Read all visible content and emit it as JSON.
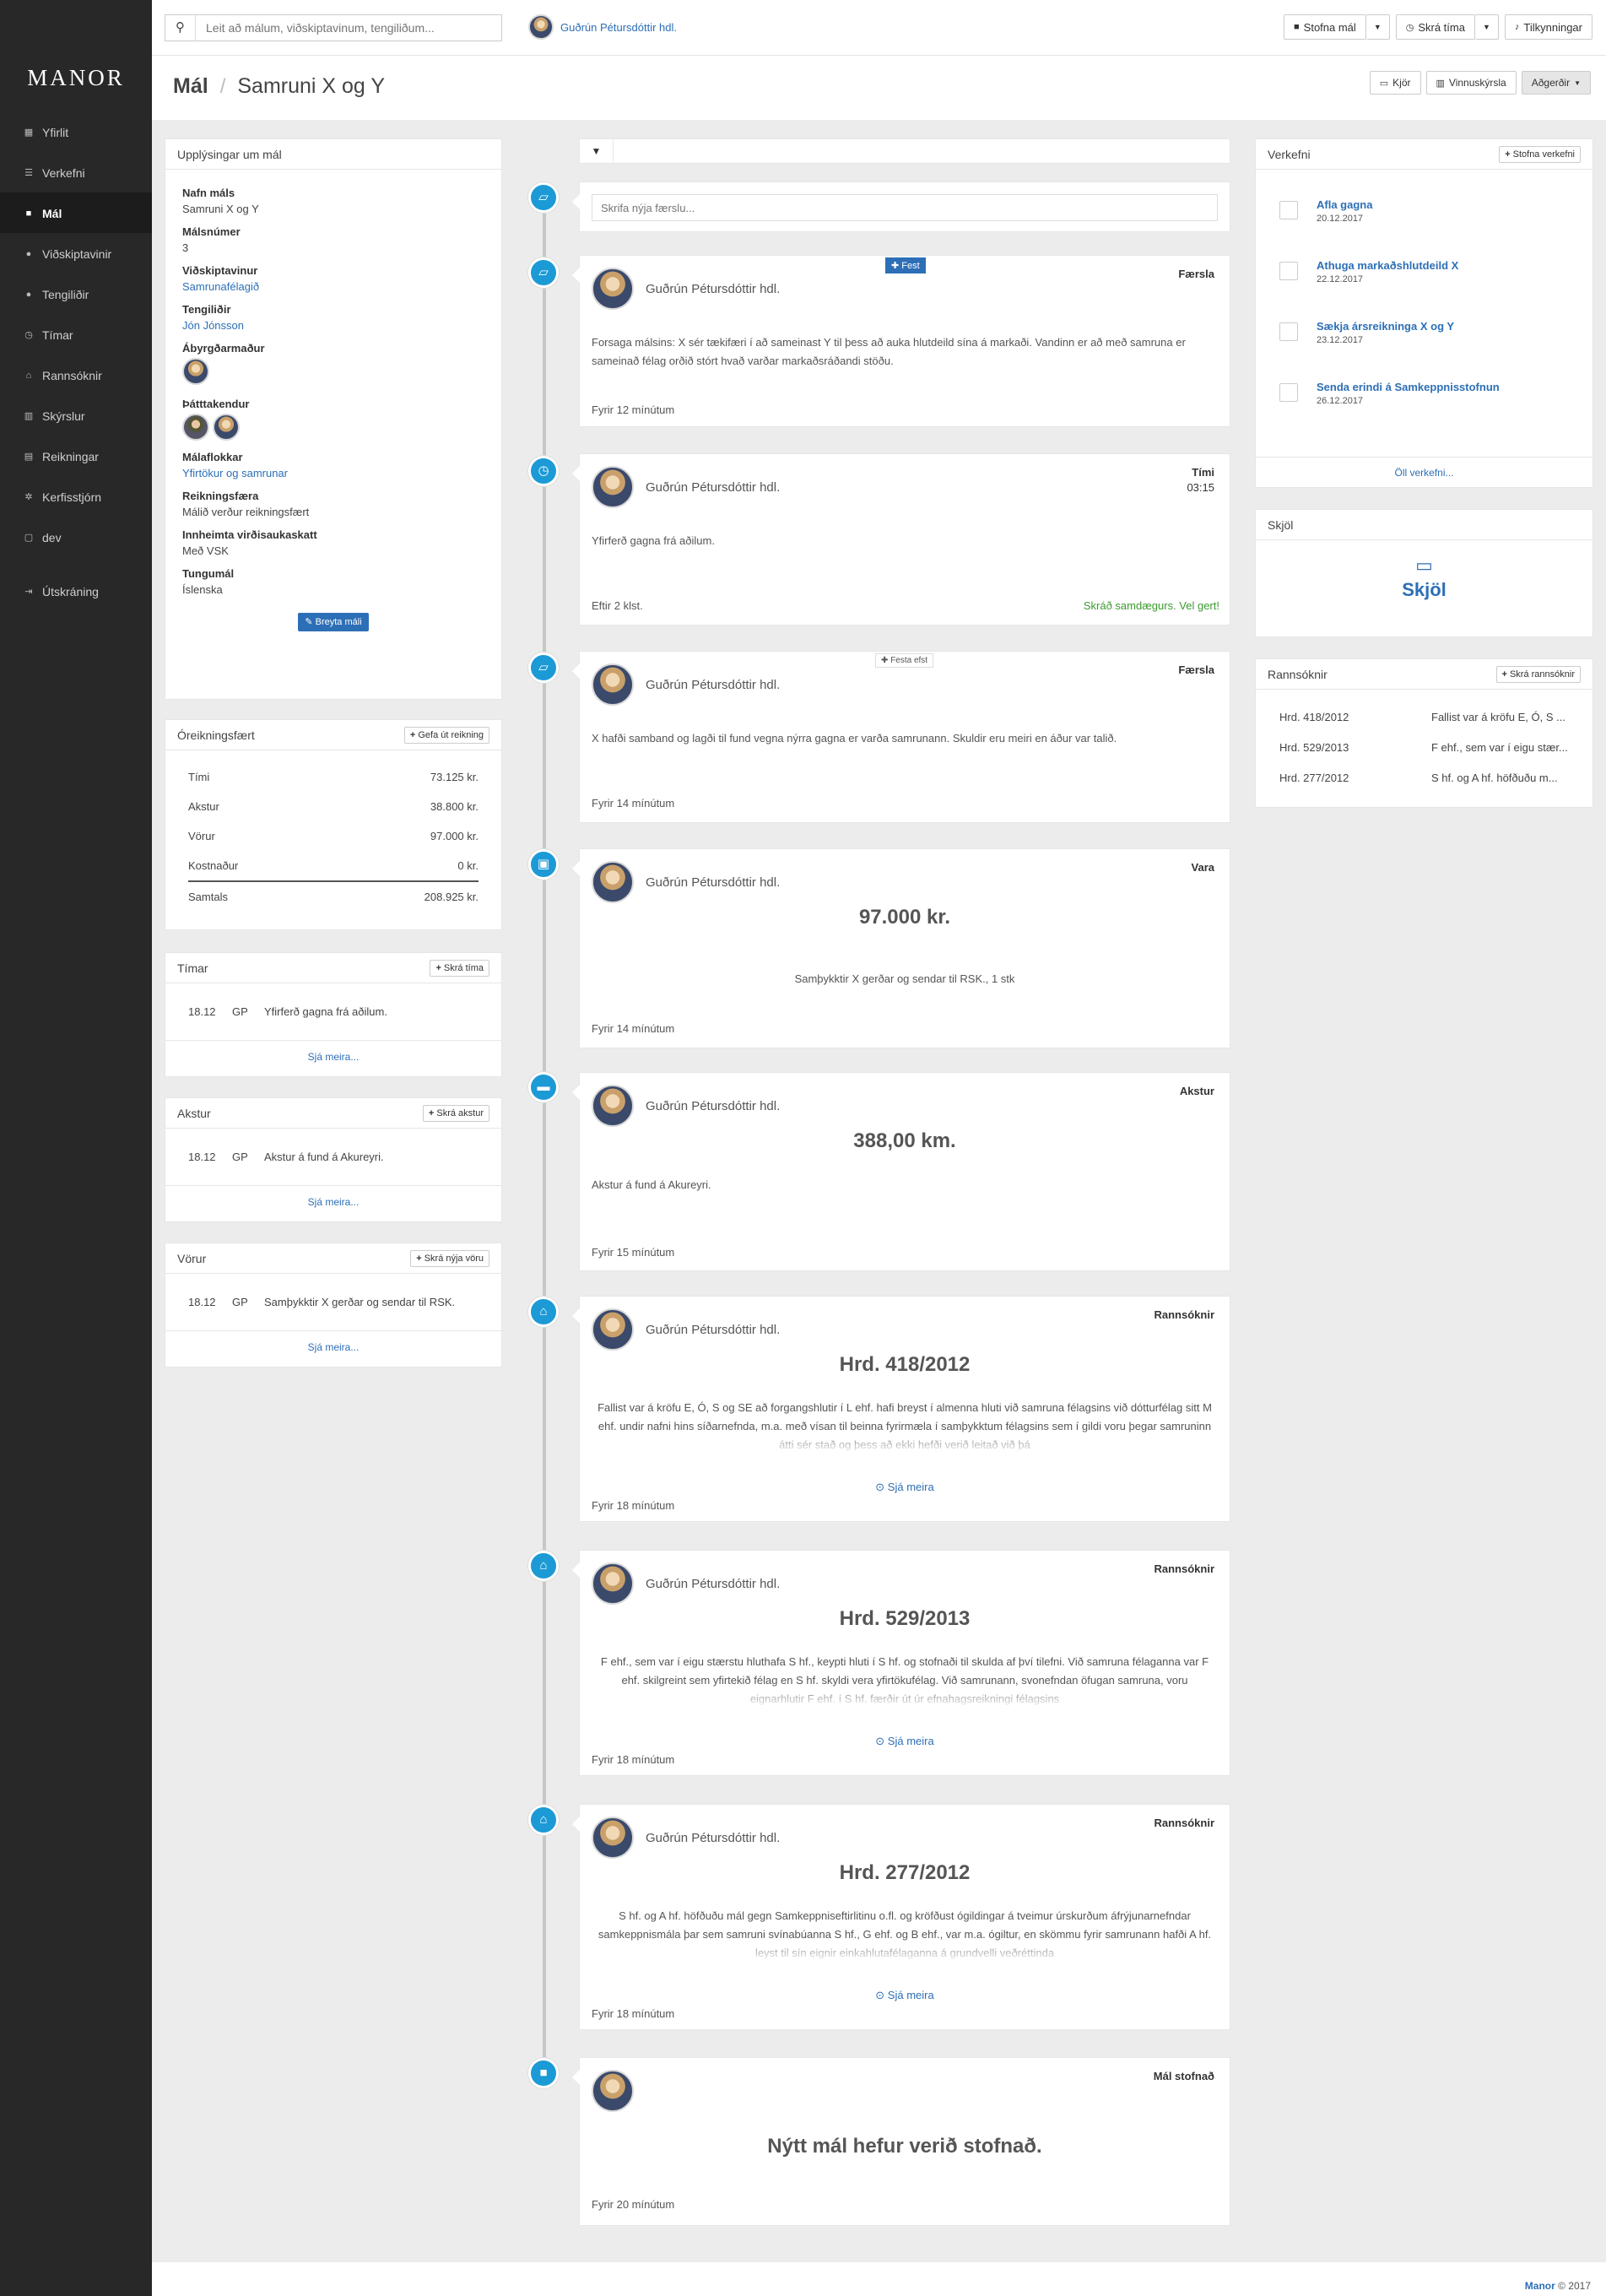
{
  "brand": "MANOR",
  "nav": [
    {
      "label": "Yfirlit",
      "icon": "dashboard-icon",
      "glyph": "▦"
    },
    {
      "label": "Verkefni",
      "icon": "tasks-icon",
      "glyph": "☰"
    },
    {
      "label": "Mál",
      "icon": "folder-icon",
      "glyph": "■"
    },
    {
      "label": "Viðskiptavinir",
      "icon": "user-icon",
      "glyph": "●"
    },
    {
      "label": "Tengiliðir",
      "icon": "users-icon",
      "glyph": "●"
    },
    {
      "label": "Tímar",
      "icon": "clock-icon",
      "glyph": "◷"
    },
    {
      "label": "Rannsóknir",
      "icon": "bank-icon",
      "glyph": "⌂"
    },
    {
      "label": "Skýrslur",
      "icon": "chart-icon",
      "glyph": "▥"
    },
    {
      "label": "Reikningar",
      "icon": "invoice-icon",
      "glyph": "▤"
    },
    {
      "label": "Kerfisstjórn",
      "icon": "gear-icon",
      "glyph": "✲"
    },
    {
      "label": "dev",
      "icon": "file-icon",
      "glyph": "▢"
    },
    {
      "label": "Útskráning",
      "icon": "logout-icon",
      "glyph": "⇥"
    }
  ],
  "topbar": {
    "search_placeholder": "Leit að málum, viðskiptavinum, tengiliðum...",
    "user": "Guðrún Pétursdóttir hdl.",
    "new_case": "Stofna mál",
    "log_time": "Skrá tíma",
    "notifications": "Tilkynningar"
  },
  "header": {
    "section": "Mál",
    "title": "Samruni X og Y",
    "kjor": "Kjör",
    "report": "Vinnuskýrsla",
    "actions": "Aðgerðir"
  },
  "info": {
    "title": "Upplýsingar um mál",
    "case_name_label": "Nafn máls",
    "case_name": "Samruni X og Y",
    "case_no_label": "Málsnúmer",
    "case_no": "3",
    "client_label": "Viðskiptavinur",
    "client": "Samrunafélagið",
    "contact_label": "Tengiliðir",
    "contact": "Jón Jónsson",
    "responsible_label": "Ábyrgðarmaður",
    "participants_label": "Þátttakendur",
    "category_label": "Málaflokkar",
    "category": "Yfirtökur og samrunar",
    "billing_label": "Reikningsfæra",
    "billing": "Málið verður reikningsfært",
    "vat_label": "Innheimta virðisaukaskatt",
    "vat": "Með VSK",
    "language_label": "Tungumál",
    "language": "Íslenska",
    "edit": "Breyta máli"
  },
  "unbilled": {
    "title": "Óreikningsfært",
    "button": "Gefa út reikning",
    "rows": [
      {
        "label": "Tími",
        "value": "73.125 kr."
      },
      {
        "label": "Akstur",
        "value": "38.800 kr."
      },
      {
        "label": "Vörur",
        "value": "97.000 kr."
      },
      {
        "label": "Kostnaður",
        "value": "0 kr."
      }
    ],
    "total_label": "Samtals",
    "total": "208.925 kr."
  },
  "times": {
    "title": "Tímar",
    "button": "Skrá tíma",
    "date": "18.12",
    "user": "GP",
    "text": "Yfirferð gagna frá aðilum.",
    "more": "Sjá meira..."
  },
  "driving": {
    "title": "Akstur",
    "button": "Skrá akstur",
    "date": "18.12",
    "user": "GP",
    "text": "Akstur á fund á Akureyri.",
    "more": "Sjá meira..."
  },
  "goods": {
    "title": "Vörur",
    "button": "Skrá nýja vöru",
    "date": "18.12",
    "user": "GP",
    "text": "Samþykktir X gerðar og sendar til RSK.",
    "more": "Sjá meira..."
  },
  "timeline": {
    "new_entry_placeholder": "Skrifa nýja færslu...",
    "author": "Guðrún Pétursdóttir hdl.",
    "pinned": "Fest",
    "pin": "Festa efst",
    "see_more": "Sjá meira",
    "entries": [
      {
        "type": "Færsla",
        "text": "Forsaga málsins: X sér tækifæri í að sameinast Y til þess að auka hlutdeild sína á markaði. Vandinn er að með samruna er sameinað félag orðið stórt hvað varðar markaðsráðandi stöðu.",
        "time": "Fyrir 12 mínútum"
      },
      {
        "type": "Tími",
        "duration": "03:15",
        "text": "Yfirferð gagna frá aðilum.",
        "time": "Eftir 2 klst.",
        "status": "Skráð samdægurs. Vel gert!"
      },
      {
        "type": "Færsla",
        "text": "X hafði samband og lagði til fund vegna nýrra gagna er varða samrunann. Skuldir eru meiri en áður var talið.",
        "time": "Fyrir 14 mínútum"
      },
      {
        "type": "Vara",
        "value": "97.000 kr.",
        "text": "Samþykktir X gerðar og sendar til RSK., 1 stk",
        "time": "Fyrir 14 mínútum"
      },
      {
        "type": "Akstur",
        "value": "388,00 km.",
        "text": "Akstur á fund á Akureyri.",
        "time": "Fyrir 15 mínútum"
      },
      {
        "type": "Rannsóknir",
        "value": "Hrd. 418/2012",
        "text": "Fallist var á kröfu E, Ó, S og SE að forgangshlutir í L ehf. hafi breyst í almenna hluti við samruna félagsins við dótturfélag sitt M ehf. undir nafni hins síðarnefnda, m.a. með vísan til beinna fyrirmæla í samþykktum félagsins sem í gildi voru þegar samruninn átti sér stað og þess að ekki hefði verið leitað við þá",
        "time": "Fyrir 18 mínútum"
      },
      {
        "type": "Rannsóknir",
        "value": "Hrd. 529/2013",
        "text": "F ehf., sem var í eigu stærstu hluthafa S hf., keypti hluti í S hf. og stofnaði til skulda af því tilefni. Við samruna félaganna var F ehf. skilgreint sem yfirtekið félag en S hf. skyldi vera yfirtökufélag. Við samrunann, svonefndan öfugan samruna, voru eignarhlutir F ehf. í S hf. færðir út úr efnahagsreikningi félagsins",
        "time": "Fyrir 18 mínútum"
      },
      {
        "type": "Rannsóknir",
        "value": "Hrd. 277/2012",
        "text": "S hf. og A hf. höfðuðu mál gegn Samkeppniseftirlitinu o.fl. og kröfðust ógildingar á tveimur úrskurðum áfrýjunarnefndar samkeppnismála þar sem samruni svínabúanna S hf., G ehf. og B ehf., var m.a. ógiltur, en skömmu fyrir samrunann hafði A hf. leyst til sín eignir einkahlutafélaganna á grundvelli veðréttinda",
        "time": "Fyrir 18 mínútum"
      },
      {
        "type": "Mál stofnað",
        "value": "Nýtt mál hefur verið stofnað.",
        "time": "Fyrir 20 mínútum"
      }
    ]
  },
  "tasks": {
    "title": "Verkefni",
    "button": "Stofna verkefni",
    "items": [
      {
        "name": "Afla gagna",
        "date": "20.12.2017"
      },
      {
        "name": "Athuga markaðshlutdeild X",
        "date": "22.12.2017"
      },
      {
        "name": "Sækja ársreikninga X og Y",
        "date": "23.12.2017"
      },
      {
        "name": "Senda erindi á Samkeppnisstofnun",
        "date": "26.12.2017"
      }
    ],
    "all": "Öll verkefni..."
  },
  "documents": {
    "title": "Skjöl",
    "label": "Skjöl"
  },
  "research": {
    "title": "Rannsóknir",
    "button": "Skrá rannsóknir",
    "items": [
      {
        "case": "Hrd. 418/2012",
        "desc": "Fallist var á kröfu E, Ó, S ..."
      },
      {
        "case": "Hrd. 529/2013",
        "desc": "F ehf., sem var í eigu stær..."
      },
      {
        "case": "Hrd. 277/2012",
        "desc": "S hf. og A hf. höfðuðu m..."
      }
    ]
  },
  "footer": {
    "brand": "Manor",
    "year": "© 2017"
  }
}
